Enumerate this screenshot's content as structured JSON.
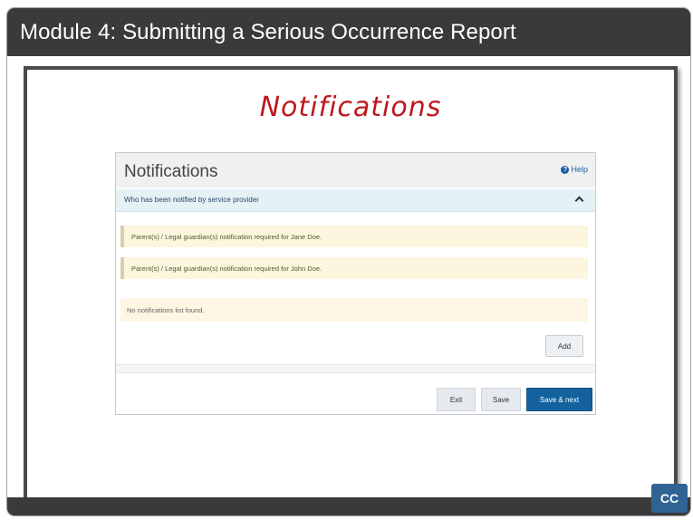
{
  "window": {
    "title": "Module 4:  Submitting a Serious Occurrence Report"
  },
  "slide": {
    "heading": "Notifications"
  },
  "panel": {
    "title": "Notifications",
    "help_label": "Help",
    "section_label": "Who has been notified by service provider",
    "alerts": [
      "Parent(s) / Legal guardian(s) notification required for Jane Doe.",
      "Parent(s) / Legal guardian(s) notification required for John Doe."
    ],
    "empty_message": "No notifications list found.",
    "add_label": "Add",
    "footer": {
      "exit_label": "Exit",
      "save_label": "Save",
      "save_next_label": "Save & next"
    }
  },
  "player": {
    "cc_label": "CC"
  },
  "colors": {
    "title_bar": "#3a3a3a",
    "heading": "#c0171e",
    "primary_button": "#14629d",
    "cc_button": "#2f6394"
  }
}
